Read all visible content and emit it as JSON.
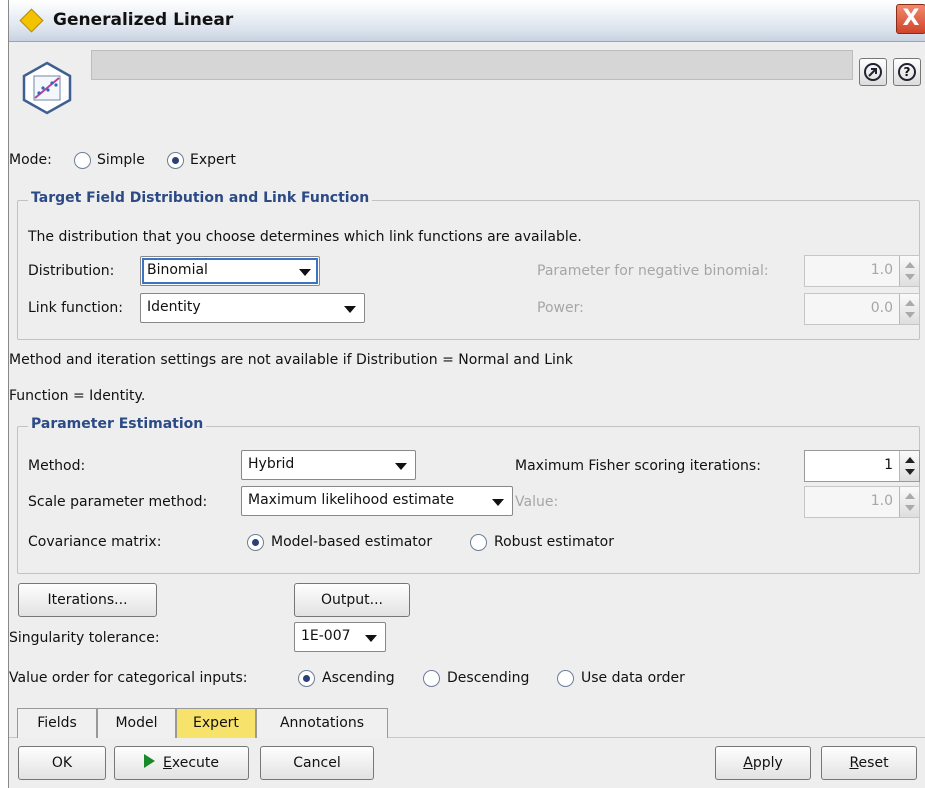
{
  "window": {
    "title": "Generalized Linear",
    "close": "X"
  },
  "header": {
    "help_label": "?"
  },
  "mode": {
    "label": "Mode:",
    "simple": "Simple",
    "expert": "Expert",
    "selected": "Expert"
  },
  "target_group": {
    "title": "Target Field Distribution and Link Function",
    "note": "The distribution that you choose determines which link functions are available.",
    "distribution_label": "Distribution:",
    "distribution_value": "Binomial",
    "link_label": "Link function:",
    "link_value": "Identity",
    "param_neg_binomial_label": "Parameter for negative binomial:",
    "param_neg_binomial_value": "1.0",
    "power_label": "Power:",
    "power_value": "0.0"
  },
  "method_note": {
    "line1": "Method and iteration settings are not available if Distribution = Normal and Link",
    "line2": "Function = Identity."
  },
  "estimation_group": {
    "title": "Parameter Estimation",
    "method_label": "Method:",
    "method_value": "Hybrid",
    "max_fisher_label": "Maximum Fisher scoring iterations:",
    "max_fisher_value": "1",
    "scale_label": "Scale parameter method:",
    "scale_value": "Maximum likelihood estimate",
    "value_label": "Value:",
    "value_value": "1.0",
    "cov_label": "Covariance matrix:",
    "cov_model": "Model-based estimator",
    "cov_robust": "Robust estimator",
    "cov_selected": "Model-based estimator"
  },
  "buttons_mid": {
    "iterations": "Iterations...",
    "output": "Output..."
  },
  "singularity": {
    "label": "Singularity tolerance:",
    "value": "1E-007"
  },
  "value_order": {
    "label": "Value order for categorical inputs:",
    "ascending": "Ascending",
    "descending": "Descending",
    "data_order": "Use data order",
    "selected": "Ascending"
  },
  "tabs": [
    {
      "label": "Fields"
    },
    {
      "label": "Model"
    },
    {
      "label": "Expert",
      "active": true
    },
    {
      "label": "Annotations"
    }
  ],
  "footer": {
    "ok": "OK",
    "execute_prefix": "",
    "execute_underlined": "E",
    "execute_rest": "xecute",
    "cancel": "Cancel",
    "apply_u": "A",
    "apply_rest": "pply",
    "reset_u": "R",
    "reset_rest": "eset"
  },
  "colors": {
    "accent_title": "#2c4a86",
    "active_tab": "#f7e26b",
    "close": "#d0442a"
  }
}
